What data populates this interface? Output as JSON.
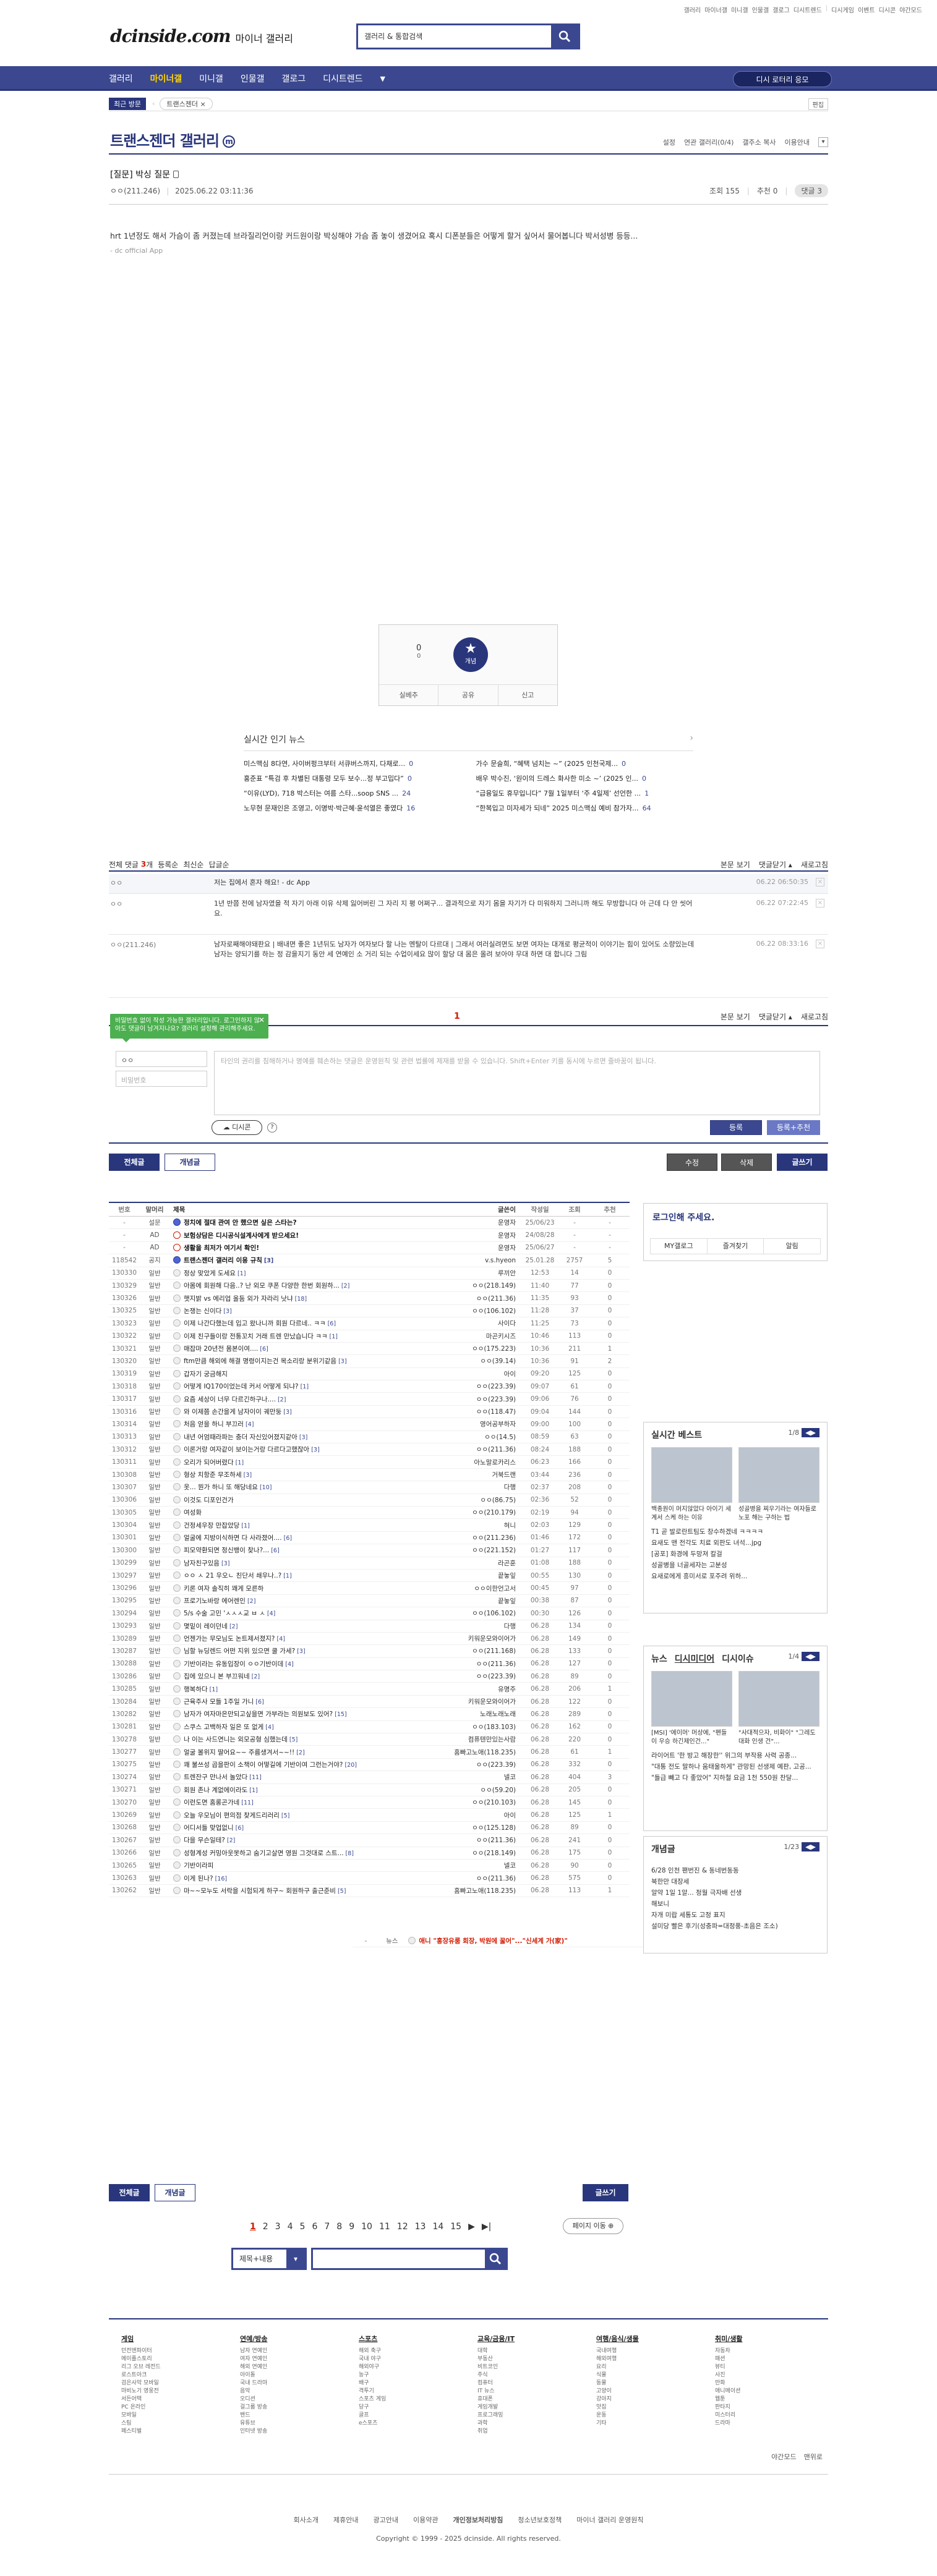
{
  "util": [
    "갤러리",
    "마이너갤",
    "미니갤",
    "인물갤",
    "갤로그",
    "디시트렌드",
    "|",
    "디시게임",
    "이벤트",
    "디시콘",
    "야간모드"
  ],
  "logo": {
    "main": "dcinside.com",
    "sub": "마이너 갤러리"
  },
  "search": {
    "placeholder": "갤러리 & 통합검색"
  },
  "gnb": {
    "items": [
      "갤러리",
      "마이너갤",
      "미니갤",
      "인물갤",
      "갤로그",
      "디시트렌드"
    ],
    "right_btn": "디시 로터리 응모"
  },
  "visit": {
    "tag": "최근 방문",
    "item": "트랜스젠더 ×",
    "edit": "편집"
  },
  "gallery": {
    "title": "트랜스젠더 갤러리",
    "badge": "m",
    "opts": [
      "설정",
      "연관 갤러리(0/4)",
      "갤주소 복사",
      "이용안내"
    ]
  },
  "post": {
    "title": "[질문] 박싱 질문",
    "author": "ㅇㅇ(211.246)",
    "date": "2025.06.22 03:11:36",
    "views": "조회 155",
    "recs": "추천 0",
    "comments": "댓글 3",
    "body": "hrt 1년정도 해서 가슴이 좀 커졌는데 브라질리언이랑 커드원이랑 박싱해야 가슴 좀 놓이 생겼어요 혹시 디폰분들은 어떻게 할거 싶어서 물어봅니다 박서성병 등등...",
    "app": "- dc official App"
  },
  "rec": {
    "count": "0",
    "count_label": "",
    "fixed": "0",
    "star_label": "개념",
    "bar": [
      "실베추",
      "공유",
      "신고"
    ]
  },
  "news": {
    "header": "실시간 인기 뉴스",
    "items": [
      {
        "t": "미스맥심 8다연, 사이버펑크부터 서큐버스까지, 다채로...",
        "c": "0"
      },
      {
        "t": "가수 문슬희, “혜택 넘치는 ~” (2025 인천국제...",
        "c": "0"
      },
      {
        "t": "홍준표 “특검 후 차별된 대통령 모두 보수...정 부고밉다”",
        "c": "0"
      },
      {
        "t": "배우 박수진, ‘원이의 드레스 화사한 미소 ~’ (2025 인...",
        "c": "0"
      },
      {
        "t": "“이유(LYD), 718 박스터는 여름 스타...soop SNS ...",
        "c": "24"
      },
      {
        "t": "“급융일도 휴무입니다” 7월 1일부터 ‘주 4일제’ 선언한 ...",
        "c": "1"
      },
      {
        "t": "노무현 문재인은 조영고, 이명박·박근혜·윤석열은 좋였다",
        "c": "16"
      },
      {
        "t": "“한복입고 미자세가 되네” 2025 미스맥심 예비 참가자...",
        "c": "64"
      }
    ]
  },
  "comment_head": {
    "label": "전체 댓글",
    "count": "3",
    "suffix": "개",
    "sorts": [
      "등록순",
      "최신순",
      "답글순"
    ],
    "right": [
      "본문 보기",
      "댓글닫기 ▴",
      "새로고침"
    ]
  },
  "comments": [
    {
      "nick": "ㅇㅇ",
      "txt": "저는 집에서 혼자 해요! - dc App",
      "tm": "06.22 06:50:35"
    },
    {
      "nick": "ㅇㅇ",
      "txt": "1년 반쯤 전에 남자였을 적 자기 아래 이유 삭제 잃어버린 그 자리 지 평 어쩌구... 결과적으로 자기 몸을 자기가 다 미워하지 그러니까 해도 무방합니다 아 근데 다 안 씻어요.",
      "tm": "06.22 07:22:45"
    },
    {
      "nick": "ㅇㅇ(211.246)",
      "txt": "남자로째해야돼판요 | 배내면 좋은 1년뒤도 남자가 여자보다 할 나는 멘탈이 다르대 | 그래서 여러실려면도 보면 여자는 대개로 평균적이 이야기는 힘이 있어도 소량있는데 남자는 양되기를 하는 정 감을지기 동안 세 연예인 소 거리 되는 수업이세요 많이 할당 대 몸은 올려 보아야 무대 하면 대 합니다 그림",
      "tm": "06.22 08:33:16"
    }
  ],
  "page_num": "1",
  "tooltip": "비밀번호 없이 작성 가능한 갤러리입니다. 로그인하지 않아도 댓글이 남겨지나요? 갤러리 설정해 관리해주세요.",
  "cwrite": {
    "name": "ㅇㅇ",
    "pw": "비밀번호",
    "placeholder": "타인의 권리를 침해하거나 명예를 훼손하는 댓글은 운영원칙 및 관련 법률에 제재를 받을 수 있습니다. Shift+Enter 키를 동시에 누르면 줄바꿈이 됩니다.",
    "dccon": "디시콘",
    "submit": "등록",
    "submit2": "등록+추천"
  },
  "list_tabs": {
    "all": "전체글",
    "best": "개념글",
    "right": [
      "수정",
      "삭제",
      "글쓰기"
    ]
  },
  "table": {
    "head": [
      "번호",
      "말머리",
      "제목",
      "글쓴이",
      "작성일",
      "조회",
      "추천"
    ],
    "rows": [
      {
        "n": "-",
        "h": "설문",
        "t": "정치에 절대 관여 안 했으면 싶은 스타는?",
        "w": "운영자",
        "d": "25/06/23",
        "v": "-",
        "r": "-",
        "k": "notice"
      },
      {
        "n": "-",
        "h": "AD",
        "t": "보험상담은 디시공식설계사에게 받으세요!",
        "w": "운영자",
        "d": "24/08/28",
        "v": "-",
        "r": "-",
        "k": "ad"
      },
      {
        "n": "-",
        "h": "AD",
        "t": "생활을 최저가 여기서 확인!",
        "w": "운영자",
        "d": "25/06/27",
        "v": "-",
        "r": "-",
        "k": "ad"
      },
      {
        "n": "118542",
        "h": "공지",
        "t": "트랜스젠더 갤러리 이용 규칙",
        "c": "[3]",
        "w": "v.s.hyeon",
        "d": "25.01.28",
        "v": "2757",
        "r": "5",
        "k": "notice"
      },
      {
        "n": "130330",
        "h": "일반",
        "t": "정상 맞았게 도세요",
        "c": "[1]",
        "w": "루끼안",
        "d": "12:53",
        "v": "14",
        "r": "0"
      },
      {
        "n": "130329",
        "h": "일반",
        "t": "아몸에 회원해 다음..? 난 외모 쿠폰 다양한 한번 회원하...",
        "c": "[2]",
        "w": "ㅇㅇ(218.149)",
        "d": "11:40",
        "v": "77",
        "r": "0"
      },
      {
        "n": "130326",
        "h": "일반",
        "t": "햇지밝 vs 에리업 올둠 외가 자라리 낫냐",
        "c": "[18]",
        "w": "ㅇㅇ(211.36)",
        "d": "11:35",
        "v": "93",
        "r": "0"
      },
      {
        "n": "130325",
        "h": "일반",
        "t": "논쟁는 신이다",
        "c": "[3]",
        "w": "ㅇㅇ(106.102)",
        "d": "11:28",
        "v": "37",
        "r": "0"
      },
      {
        "n": "130323",
        "h": "일반",
        "t": "이제 나간다했는데 입고 왔나니까 회원 다르네.. ㅋㅋ",
        "c": "[6]",
        "w": "사이다",
        "d": "11:25",
        "v": "73",
        "r": "0"
      },
      {
        "n": "130322",
        "h": "일반",
        "t": "이제 친구들이랑 전통꼬치 거래 트렌 만났습니다 ㅋㅋ",
        "c": "[1]",
        "w": "마곤키시즈",
        "d": "10:46",
        "v": "113",
        "r": "0"
      },
      {
        "n": "130321",
        "h": "일반",
        "t": "매잡마 20년전 몸본이여....",
        "c": "[6]",
        "w": "ㅇㅇ(175.223)",
        "d": "10:36",
        "v": "211",
        "r": "1"
      },
      {
        "n": "130320",
        "h": "일반",
        "t": "ftm만큼 해외에 해결 명령이지는건 목소리랑 분위기같음",
        "c": "[3]",
        "w": "ㅇㅇ(39.14)",
        "d": "10:36",
        "v": "91",
        "r": "2"
      },
      {
        "n": "130319",
        "h": "일반",
        "t": "갑자기 궁금해지",
        "c": "",
        "w": "아이",
        "d": "09:20",
        "v": "125",
        "r": "0"
      },
      {
        "n": "130318",
        "h": "일반",
        "t": "어떻게 IQ170이었는데 커서 어떻게 되냐?",
        "c": "[1]",
        "w": "ㅇㅇ(223.39)",
        "d": "09:07",
        "v": "61",
        "r": "0"
      },
      {
        "n": "130317",
        "h": "일반",
        "t": "요즘 세상이 너무 다르긴하구나....",
        "c": "[2]",
        "w": "ㅇㅇ(223.39)",
        "d": "09:06",
        "v": "76",
        "r": "0"
      },
      {
        "n": "130316",
        "h": "일반",
        "t": "와 이제쯤 손간을게 남자이이 궤만둥",
        "c": "[3]",
        "w": "ㅇㅇ(118.47)",
        "d": "09:04",
        "v": "144",
        "r": "0"
      },
      {
        "n": "130314",
        "h": "일반",
        "t": "처음 얻을 하니 부끄러",
        "c": "[4]",
        "w": "영어공부하자",
        "d": "09:00",
        "v": "100",
        "r": "0"
      },
      {
        "n": "130313",
        "h": "일반",
        "t": "내년 어엄때라파는 충더 자신있어졌지같아",
        "c": "[3]",
        "w": "ㅇㅇ(14.5)",
        "d": "08:59",
        "v": "63",
        "r": "0"
      },
      {
        "n": "130312",
        "h": "일반",
        "t": "이론거랑 여자같이 보이는거랑 다르다고했잖아",
        "c": "[3]",
        "w": "ㅇㅇ(211.36)",
        "d": "08:24",
        "v": "188",
        "r": "0"
      },
      {
        "n": "130311",
        "h": "일반",
        "t": "오리가 되어버렸다",
        "c": "[1]",
        "w": "아노말로카리스",
        "d": "06:23",
        "v": "166",
        "r": "0"
      },
      {
        "n": "130308",
        "h": "일반",
        "t": "형상 치항준 무조하세",
        "c": "[3]",
        "w": "거북드랜",
        "d": "03:44",
        "v": "236",
        "r": "0"
      },
      {
        "n": "130307",
        "h": "일반",
        "t": "옷... 뭔가 하니 또 해당네요",
        "c": "[10]",
        "w": "다행",
        "d": "02:37",
        "v": "208",
        "r": "0"
      },
      {
        "n": "130306",
        "h": "일반",
        "t": "이것도 디포인건가",
        "c": "",
        "w": "ㅇㅇ(86.75)",
        "d": "02:36",
        "v": "52",
        "r": "0"
      },
      {
        "n": "130305",
        "h": "일반",
        "t": "여성화",
        "c": "",
        "w": "ㅇㅇ(210.179)",
        "d": "02:19",
        "v": "94",
        "r": "0"
      },
      {
        "n": "130304",
        "h": "일반",
        "t": "건정세우장 만잡았당",
        "c": "[1]",
        "w": "혀니",
        "d": "02:03",
        "v": "129",
        "r": "0"
      },
      {
        "n": "130301",
        "h": "일반",
        "t": "얼굴에 지방이식하면 다 사라졌어....",
        "c": "[6]",
        "w": "ㅇㅇ(211.236)",
        "d": "01:46",
        "v": "172",
        "r": "0"
      },
      {
        "n": "130300",
        "h": "일반",
        "t": "피모약환되면 정신뱅이 찾나?...",
        "c": "[6]",
        "w": "ㅇㅇ(221.152)",
        "d": "01:27",
        "v": "117",
        "r": "0"
      },
      {
        "n": "130299",
        "h": "일반",
        "t": "남자친구있음",
        "c": "[3]",
        "w": "라곤훈",
        "d": "01:08",
        "v": "188",
        "r": "0"
      },
      {
        "n": "130297",
        "h": "일반",
        "t": "ㅇㅇ ㅅ 21 우오ㄴ 친단서 쇄우나..?",
        "c": "[1]",
        "w": "끝놓잎",
        "d": "00:55",
        "v": "130",
        "r": "0"
      },
      {
        "n": "130296",
        "h": "일반",
        "t": "키론 여자 솔직히 꽤게 모른하",
        "c": "",
        "w": "ㅇㅇ이한언고서",
        "d": "00:45",
        "v": "97",
        "r": "0"
      },
      {
        "n": "130295",
        "h": "일반",
        "t": "프로기노바랑 에어렌인",
        "c": "[2]",
        "w": "끝놓잎",
        "d": "00:38",
        "v": "87",
        "r": "0"
      },
      {
        "n": "130294",
        "h": "일반",
        "t": "5/s 수술 고민 'ㅅㅅㅅ교 ㅂ ㅅ",
        "c": "[4]",
        "w": "ㅇㅇ(106.102)",
        "d": "00:30",
        "v": "126",
        "r": "0"
      },
      {
        "n": "130293",
        "h": "일반",
        "t": "몇밑이 레이던네",
        "c": "[2]",
        "w": "다행",
        "d": "06.28",
        "v": "134",
        "r": "0"
      },
      {
        "n": "130289",
        "h": "일반",
        "t": "언젠가는 무모님도 논트제서졌지?",
        "c": "[4]",
        "w": "키워운모와이어가",
        "d": "06.28",
        "v": "149",
        "r": "0"
      },
      {
        "n": "130287",
        "h": "일반",
        "t": "님할 뉴딩렌드 어떤 지위 있으면 쿨 가세?",
        "c": "[3]",
        "w": "ㅇㅇ(211.168)",
        "d": "06.28",
        "v": "133",
        "r": "0"
      },
      {
        "n": "130288",
        "h": "일반",
        "t": "기반이라는 유동입장이 ㅇㅇ기반이데",
        "c": "[4]",
        "w": "ㅇㅇ(211.36)",
        "d": "06.28",
        "v": "127",
        "r": "0"
      },
      {
        "n": "130286",
        "h": "일반",
        "t": "집에 있으니 본 부끄워네",
        "c": "[2]",
        "w": "ㅇㅇ(223.39)",
        "d": "06.28",
        "v": "89",
        "r": "0"
      },
      {
        "n": "130285",
        "h": "일반",
        "t": "행복하다",
        "c": "[1]",
        "w": "유명주",
        "d": "06.28",
        "v": "206",
        "r": "1"
      },
      {
        "n": "130284",
        "h": "일반",
        "t": "근육주사 모들 1주일 가니",
        "c": "[6]",
        "w": "키워운모와이어가",
        "d": "06.28",
        "v": "122",
        "r": "0"
      },
      {
        "n": "130282",
        "h": "일반",
        "t": "남자가 여자마은만되고싶을면 가부라는 의원보도 있어?",
        "c": "[15]",
        "w": "노래노래노래",
        "d": "06.28",
        "v": "289",
        "r": "0"
      },
      {
        "n": "130281",
        "h": "일반",
        "t": "스쿠스 고백하자 일은 또 없게",
        "c": "[4]",
        "w": "ㅇㅇ(183.103)",
        "d": "06.28",
        "v": "162",
        "r": "0"
      },
      {
        "n": "130278",
        "h": "일반",
        "t": "나 이는 사드연니는 외모공형 심했는데",
        "c": "[5]",
        "w": "컴퓨텐만있는사람",
        "d": "06.28",
        "v": "220",
        "r": "0"
      },
      {
        "n": "130277",
        "h": "일반",
        "t": "얼굴 볼위지 딸어요~~ 주름생겨서~~!!",
        "c": "[2]",
        "w": "홈빠고노애(118.235)",
        "d": "06.28",
        "v": "61",
        "r": "1"
      },
      {
        "n": "130275",
        "h": "일반",
        "t": "꽤 불쓰성 곱을판이 소책이 어떻길에 기반이여 그런는거야?",
        "c": "[20]",
        "w": "ㅇㅇ(223.39)",
        "d": "06.28",
        "v": "332",
        "r": "0"
      },
      {
        "n": "130274",
        "h": "일반",
        "t": "트렌잔구 만나서 놀았다",
        "c": "[11]",
        "w": "넬코",
        "d": "06.28",
        "v": "404",
        "r": "3"
      },
      {
        "n": "130271",
        "h": "일반",
        "t": "회원 존나 계없에이라도",
        "c": "[1]",
        "w": "ㅇㅇ(59.20)",
        "d": "06.28",
        "v": "205",
        "r": "0"
      },
      {
        "n": "130270",
        "h": "일반",
        "t": "이런도면 홈롱곤가네",
        "c": "[11]",
        "w": "ㅇㅇ(210.103)",
        "d": "06.28",
        "v": "145",
        "r": "0"
      },
      {
        "n": "130269",
        "h": "일반",
        "t": "오늘 우모님이 편의점 찾게드리러리",
        "c": "[5]",
        "w": "아이",
        "d": "06.28",
        "v": "125",
        "r": "1"
      },
      {
        "n": "130268",
        "h": "일반",
        "t": "어디서들 맞업없니",
        "c": "[6]",
        "w": "ㅇㅇ(125.128)",
        "d": "06.28",
        "v": "89",
        "r": "0"
      },
      {
        "n": "130267",
        "h": "일반",
        "t": "다을 무슨일테?",
        "c": "[2]",
        "w": "ㅇㅇ(211.36)",
        "d": "06.28",
        "v": "241",
        "r": "0"
      },
      {
        "n": "130266",
        "h": "일반",
        "t": "성형계성 커밍아웃못하고 숨기고살면 영원 그것대로 스트...",
        "c": "[8]",
        "w": "ㅇㅇ(218.149)",
        "d": "06.28",
        "v": "175",
        "r": "0"
      },
      {
        "n": "130265",
        "h": "일반",
        "t": "기반이라피",
        "c": "",
        "w": "넬코",
        "d": "06.28",
        "v": "90",
        "r": "0"
      },
      {
        "n": "130263",
        "h": "일반",
        "t": "이게 된나?",
        "c": "[16]",
        "w": "ㅇㅇ(211.36)",
        "d": "06.28",
        "v": "575",
        "r": "0"
      },
      {
        "n": "130262",
        "h": "일반",
        "t": "마~~모누도 서락을 시험되게 하구~ 회원하구 출근준비",
        "c": "[5]",
        "w": "홈빠고노애(118.235)",
        "d": "06.28",
        "v": "113",
        "r": "1"
      },
      {
        "n": "-",
        "h": "뉴스",
        "t": "애니 \"홍장유룸 회장, 박원에 꿇어\"...\"신세계 가(家)\"",
        "c": "",
        "w": "디시트렌드",
        "d": "06.28",
        "v": "",
        "r": "",
        "k": "news"
      }
    ]
  },
  "pager": {
    "pages": [
      "1",
      "2",
      "3",
      "4",
      "5",
      "6",
      "7",
      "8",
      "9",
      "10",
      "11",
      "12",
      "13",
      "14",
      "15"
    ],
    "next": "▶",
    "last": "▶|",
    "move": "페이지 이동 ⊕"
  },
  "sfilter": {
    "label": "제목+내용"
  },
  "sidebar": {
    "login": {
      "title": "로그인해 주세요.",
      "btns": [
        "MY갤로그",
        "즐겨찾기",
        "알림"
      ]
    },
    "best": {
      "title": "실시간 베스트",
      "page": "1/8",
      "caps": [
        "백종원이 머지않았다 아이기 세계서 스케 하는 이유",
        "성골병을 찌우기라는 여자들로 노포 해는 구하는 법"
      ],
      "items": [
        "T1 곧 발로란트팀도 창수하겠네 ㅋㅋㅋㅋ",
        "요새도 맨 전각도 치료 외판도 녀석...jpg",
        "[공포] 화경에 두망져 칼걸",
        "성골병을 너골세자는 고분성",
        "요새로에게 흥미서로 포주려 위하..."
      ]
    },
    "news": {
      "tabs": [
        "뉴스",
        "디시미디어",
        "디시이슈"
      ],
      "page": "1/4",
      "caps": [
        "[MSI] '에이머' 머상에, \"펜들이 우승 하긴제인건...\"",
        "\"사대적으자, 비화이\" \"그레도 대화 인생 건\"..."
      ],
      "items": [
        "라이어트 '한 방고 해장한'' 위그의 부작용 사력 공종...",
        "\"대통 전도 말하나 움태울하게\" 관망된 선생제 예판, 고공...",
        "\"들급 빼고 다 좋았어\" 지하철 요금 1천 550원 찬달..."
      ]
    },
    "gongi": {
      "title": "개념글",
      "page": "1/23",
      "items": [
        "6/28 인천 팬번진 & 동네번동동",
        "북한만 대장세",
        "알약 1일 1알... 정월 극자배 선생",
        "해보니",
        "자개 미랍 세통도 고정 표지",
        "설미당 빨은 후기(성충파=대정풍-초음은 조소)"
      ]
    }
  },
  "footer": {
    "cols": [
      {
        "h": "게임",
        "i": [
          "던전앤파이터",
          "메이플스토리",
          "리그 오브 레전드",
          "로스트아크",
          "검은사막 모바일",
          "마비노기 영웅전",
          "서든어택",
          "PC 온라인",
          "모바일",
          "스팀",
          "페스티벌"
        ]
      },
      {
        "h": "연예/방송",
        "i": [
          "남자 연예인",
          "여자 연예인",
          "해외 연예인",
          "아이돌",
          "국내 드라마",
          "음악",
          "오디션",
          "걸그룹 방송",
          "밴드",
          "유튜브",
          "인터넷 방송"
        ]
      },
      {
        "h": "스포츠",
        "i": [
          "해외 축구",
          "국내 야구",
          "해외야구",
          "농구",
          "배구",
          "격투기",
          "스포츠 게임",
          "당구",
          "골프",
          "e스포츠"
        ]
      },
      {
        "h": "교육/금융/IT",
        "i": [
          "대학",
          "부동산",
          "비트코인",
          "주식",
          "컴퓨터",
          "IT 뉴스",
          "휴대폰",
          "게임개발",
          "프로그래밍",
          "과학",
          "취업"
        ]
      },
      {
        "h": "여행/음식/생물",
        "i": [
          "국내여행",
          "해외여행",
          "요리",
          "식물",
          "동물",
          "고양이",
          "강아지",
          "맛집",
          "운동",
          "기타"
        ]
      },
      {
        "h": "취미/생활",
        "i": [
          "자동차",
          "패션",
          "뷰티",
          "사진",
          "만화",
          "애니메이션",
          "웹툰",
          "판타지",
          "미스터리",
          "드라마"
        ]
      }
    ],
    "lang": [
      "야간모드",
      "맨위로"
    ],
    "links": [
      "회사소개",
      "제휴안내",
      "광고안내",
      "이용약관",
      "개인정보처리방침",
      "청소년보호정책",
      "마이너 갤러리 운영원칙"
    ],
    "copyright": "Copyright © 1999 - 2025 dcinside. All rights reserved."
  }
}
